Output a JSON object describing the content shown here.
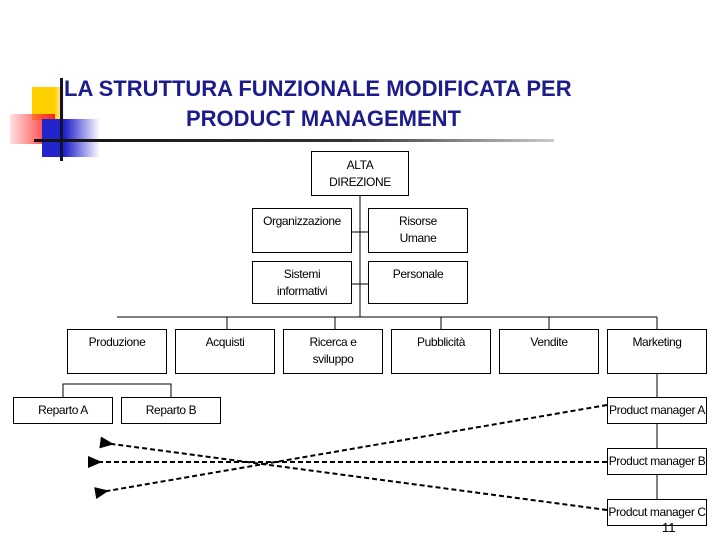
{
  "slide": {
    "title_line1": "LA STRUTTURA FUNZIONALE MODIFICATA PER",
    "title_line2": "PRODUCT MANAGEMENT",
    "page_number": "11",
    "title_color": "#1c1c8c"
  },
  "org_chart": {
    "top": {
      "line1": "ALTA",
      "line2": "DIREZIONE"
    },
    "staff": [
      {
        "line1": "Organizzazione",
        "line2": ""
      },
      {
        "line1": "Risorse",
        "line2": "Umane"
      },
      {
        "line1": "Sistemi",
        "line2": "informativi"
      },
      {
        "line1": "Personale",
        "line2": ""
      }
    ],
    "functions": [
      {
        "line1": "Produzione",
        "line2": ""
      },
      {
        "line1": "Acquisti",
        "line2": ""
      },
      {
        "line1": "Ricerca e",
        "line2": "sviluppo"
      },
      {
        "line1": "Pubblicità",
        "line2": ""
      },
      {
        "line1": "Vendite",
        "line2": ""
      },
      {
        "line1": "Marketing",
        "line2": ""
      }
    ],
    "departments": [
      {
        "label": "Reparto A"
      },
      {
        "label": "Reparto B"
      }
    ],
    "product_managers": [
      {
        "label": "Product manager A"
      },
      {
        "label": "Product manager B"
      },
      {
        "label": "Prodcut manager C"
      }
    ]
  }
}
